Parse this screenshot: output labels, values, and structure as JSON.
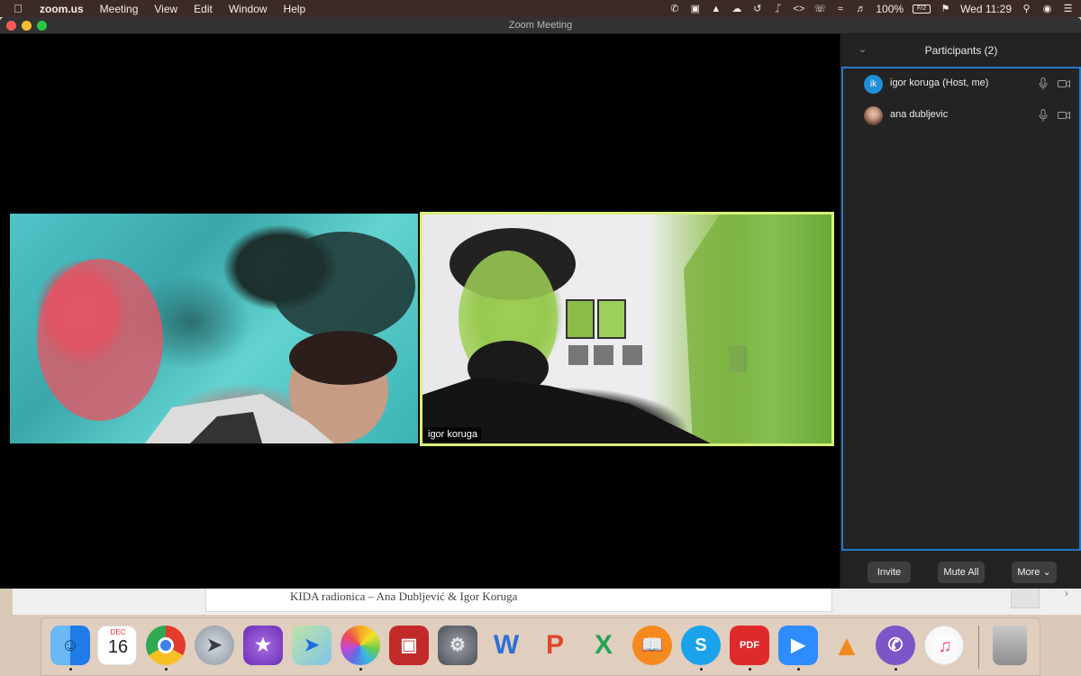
{
  "menubar": {
    "app_name": "zoom.us",
    "menus": [
      "Meeting",
      "View",
      "Edit",
      "Window",
      "Help"
    ],
    "battery_percent": "100%",
    "battery_label": "F/2",
    "clock": "Wed 11:29"
  },
  "window": {
    "title": "Zoom Meeting"
  },
  "videos": {
    "igor_name": "igor koruga"
  },
  "participants": {
    "title": "Participants (2)",
    "list": [
      {
        "initials": "ik",
        "name": "igor koruga (Host, me)"
      },
      {
        "initials": "",
        "name": "ana dubljevic"
      }
    ],
    "buttons": {
      "invite": "Invite",
      "mute_all": "Mute All",
      "more": "More"
    }
  },
  "background_doc": {
    "title": "KIDA radionica – Ana Dubljević & Igor Koruga"
  },
  "dock": {
    "calendar_month": "DEC",
    "calendar_day": "16",
    "apps": [
      "finder-icon",
      "calendar-icon",
      "chrome-icon",
      "launchpad-icon",
      "imovie-icon",
      "maps-icon",
      "photos-icon",
      "photo-booth-icon",
      "system-preferences-icon",
      "word-icon",
      "powerpoint-icon",
      "excel-icon",
      "books-icon",
      "skype-icon",
      "pdf-icon",
      "zoom-icon",
      "vlc-icon",
      "viber-icon",
      "music-icon",
      "trash-icon"
    ]
  }
}
